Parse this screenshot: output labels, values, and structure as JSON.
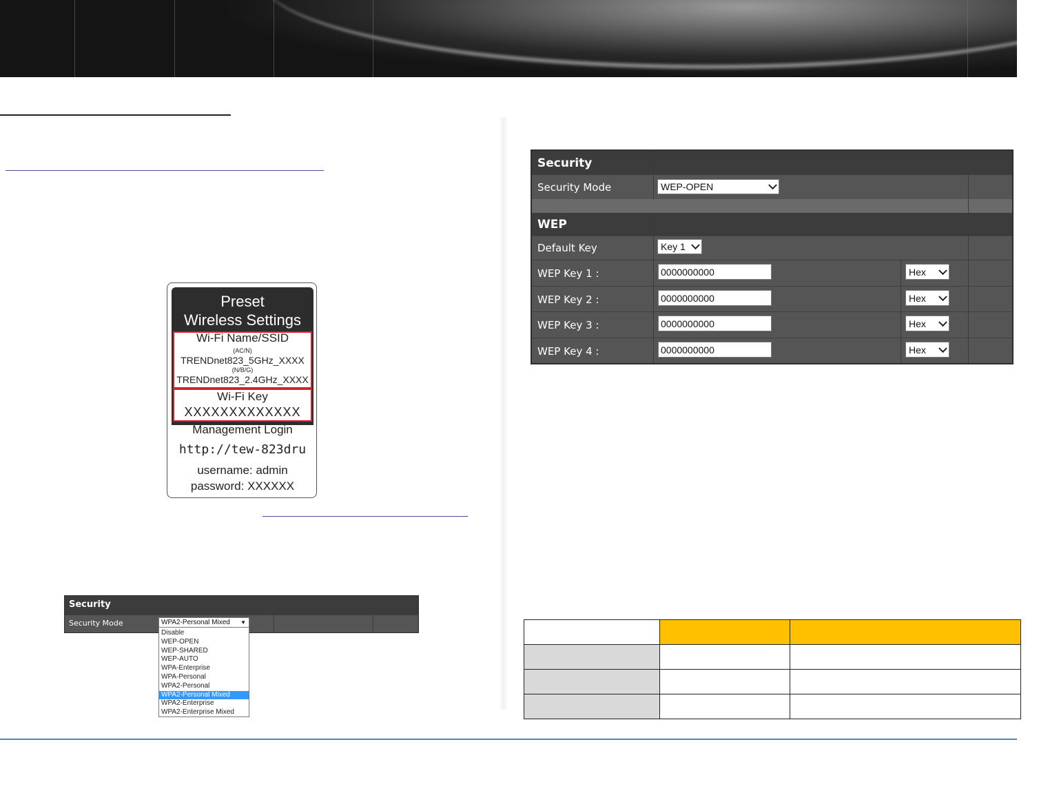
{
  "colors": {
    "banner": "#1e1e1e",
    "rule_blue": "#4f81bd",
    "panel_bg": "#555555",
    "panel_head": "#3c3c3c",
    "table_gold": "#ffc000",
    "table_gray": "#d9d9d9",
    "dropdown_highlight": "#3399ff",
    "label_red": "#d2232a"
  },
  "label_card": {
    "title_line1": "Preset",
    "title_line2": "Wireless Settings",
    "ssid_heading": "Wi-Fi Name/SSID",
    "band_5": "(AC/N)",
    "ssid_5": "TRENDnet823_5GHz_XXXX",
    "band_24": "(N/B/G)",
    "ssid_24": "TRENDnet823_2.4GHz_XXXX",
    "key_heading": "Wi-Fi Key",
    "key_value": "XXXXXXXXXXXXX",
    "mgmt_heading": "Management Login",
    "mgmt_url": "http://tew-823dru",
    "username": "username: admin",
    "password": "password: XXXXXX"
  },
  "small_panel": {
    "section": "Security",
    "field_label": "Security Mode",
    "selected": "WPA2-Personal Mixed",
    "options": [
      "Disable",
      "WEP-OPEN",
      "WEP-SHARED",
      "WEP-AUTO",
      "WPA-Enterprise",
      "WPA-Personal",
      "WPA2-Personal",
      "WPA2-Personal Mixed",
      "WPA2-Enterprise",
      "WPA2-Enterprise Mixed"
    ],
    "highlighted_index": 7
  },
  "wep_panel": {
    "security_title": "Security",
    "mode_label": "Security Mode",
    "mode_value": "WEP-OPEN",
    "wep_title": "WEP",
    "default_key_label": "Default Key",
    "default_key_value": "Key 1",
    "keys": [
      {
        "label": "WEP Key 1 :",
        "value": "0000000000",
        "format": "Hex"
      },
      {
        "label": "WEP Key 2 :",
        "value": "0000000000",
        "format": "Hex"
      },
      {
        "label": "WEP Key 3 :",
        "value": "0000000000",
        "format": "Hex"
      },
      {
        "label": "WEP Key 4 :",
        "value": "0000000000",
        "format": "Hex"
      }
    ]
  }
}
